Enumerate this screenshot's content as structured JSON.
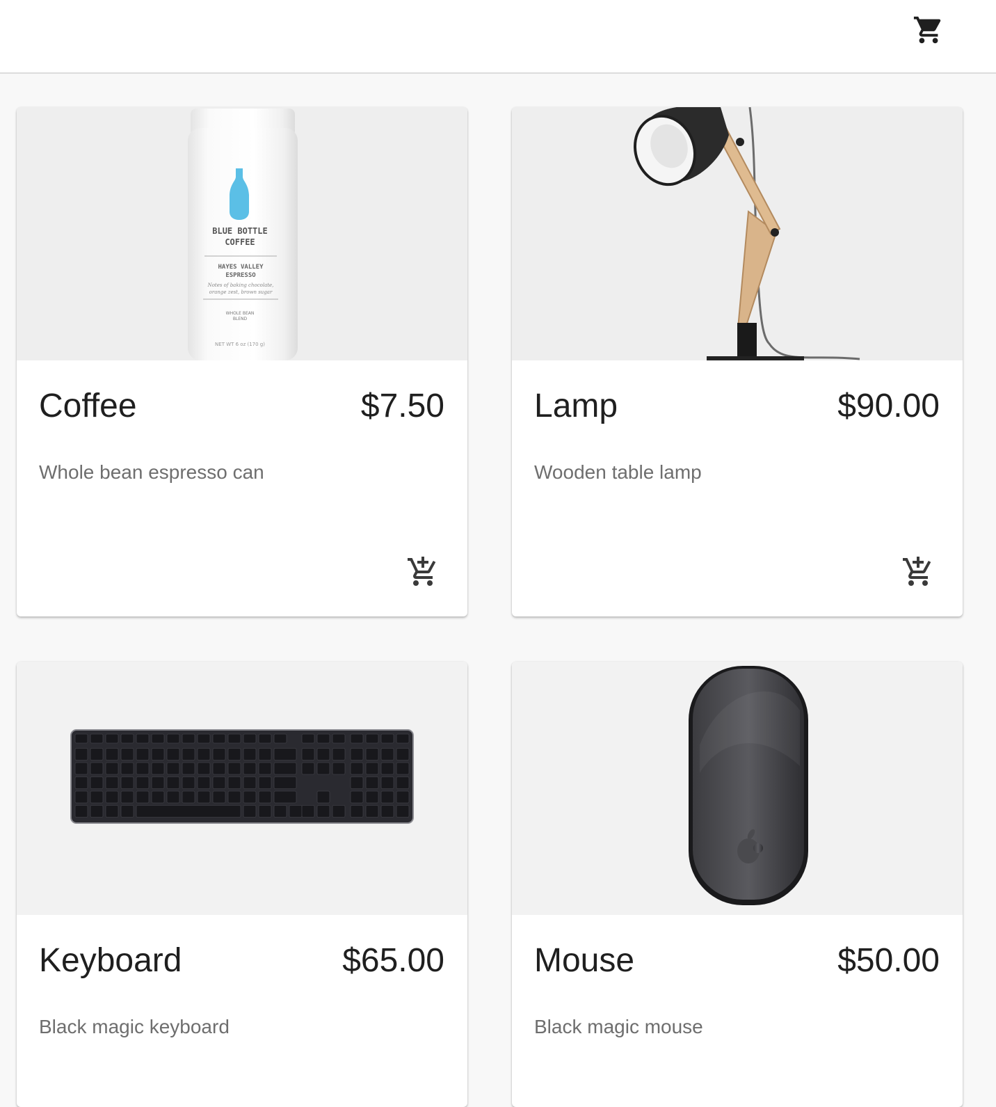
{
  "header": {
    "cart_icon": "shopping-cart-icon"
  },
  "products": [
    {
      "name": "Coffee",
      "price": "$7.50",
      "description": "Whole bean espresso can",
      "image": "coffee-can",
      "image_text": {
        "brand_line1": "BLUE BOTTLE",
        "brand_line2": "COFFEE",
        "blend_line1": "HAYES VALLEY",
        "blend_line2": "ESPRESSO",
        "notes_line1": "Notes of baking chocolate,",
        "notes_line2": "orange zest, brown sugar",
        "type_line1": "WHOLE BEAN",
        "type_line2": "BLEND",
        "weight": "NET WT 6 oz (170 g)"
      },
      "add_icon": "add-shopping-cart-icon"
    },
    {
      "name": "Lamp",
      "price": "$90.00",
      "description": "Wooden table lamp",
      "image": "desk-lamp",
      "add_icon": "add-shopping-cart-icon"
    },
    {
      "name": "Keyboard",
      "price": "$65.00",
      "description": "Black magic keyboard",
      "image": "keyboard"
    },
    {
      "name": "Mouse",
      "price": "$50.00",
      "description": "Black magic mouse",
      "image": "mouse"
    }
  ],
  "colors": {
    "page_bg": "#f8f8f8",
    "card_bg": "#ffffff",
    "title_text": "#1f1f1f",
    "desc_text": "#6e6e6e",
    "icon": "#1f1f1f",
    "accent_blue": "#5bbfe6"
  }
}
